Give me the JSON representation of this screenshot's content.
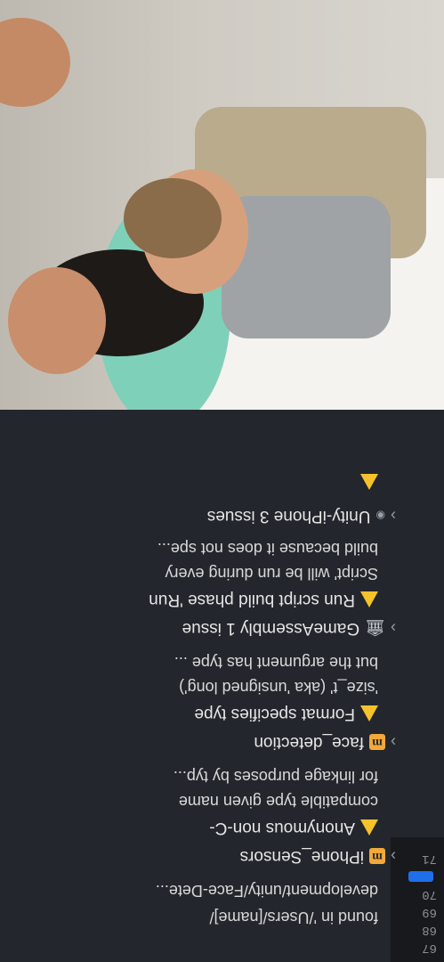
{
  "gutter": {
    "line_numbers": [
      "67",
      "68",
      "69",
      "70",
      "71"
    ]
  },
  "issues": [
    {
      "kind": "line",
      "text": "found in '/Users/[name]/"
    },
    {
      "kind": "line",
      "text": "development/unity/Face-Dete..."
    },
    {
      "kind": "group",
      "icon": "m",
      "text": "iPhone_Sensors"
    },
    {
      "kind": "warning",
      "text": "Anonymous non-C-"
    },
    {
      "kind": "line",
      "text": "compatible type given name"
    },
    {
      "kind": "line",
      "text": "for linkage purposes by typ..."
    },
    {
      "kind": "group",
      "icon": "m",
      "text": "face_detection"
    },
    {
      "kind": "warning",
      "text": "Format specifies type"
    },
    {
      "kind": "line",
      "text": "'size_t' (aka 'unsigned long')"
    },
    {
      "kind": "line",
      "text": "but the argument has type ..."
    },
    {
      "kind": "group",
      "icon": "bank",
      "text": "GameAssembly 1 issue"
    },
    {
      "kind": "warning",
      "text": "Run script build phase 'Run"
    },
    {
      "kind": "line",
      "text": "Script' will be run during every"
    },
    {
      "kind": "line",
      "text": "build because it does not spe..."
    },
    {
      "kind": "group",
      "icon": "target",
      "text": "Unity-iPhone 3 issues"
    }
  ],
  "colors": {
    "warning": "#f5c22b",
    "badge": "#f3a839",
    "accent": "#1f6feb"
  }
}
